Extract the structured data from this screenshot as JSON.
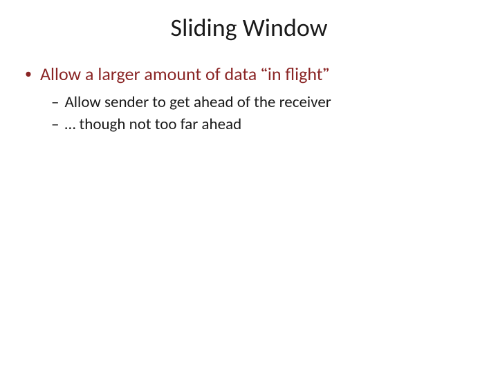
{
  "slide": {
    "title": "Sliding Window",
    "bullets": {
      "level1": {
        "item1": {
          "prefix": "Allow a larger amount of data ",
          "quote_open": "“",
          "quoted": "in flight",
          "quote_close": "”"
        }
      },
      "level2": {
        "item1": "Allow sender to get ahead of the receiver",
        "item2": "… though not too far ahead"
      }
    }
  }
}
